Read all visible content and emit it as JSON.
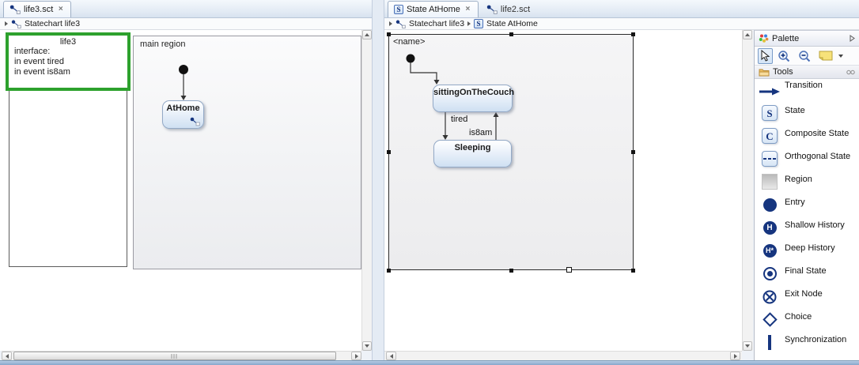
{
  "colors": {
    "navy_accent": "#16357f",
    "selection_green": "#2da12d",
    "state_border": "#93a9c6",
    "state_fill": "#cfe0f2"
  },
  "left_editor": {
    "tab_label": "life3.sct",
    "breadcrumb": {
      "item1": "Statechart life3"
    },
    "spec_box": {
      "title": "life3",
      "line1": "interface:",
      "line2": "in event tired",
      "line3": "in event is8am"
    },
    "region": {
      "label": "main region",
      "state_label": "AtHome"
    }
  },
  "right_editor": {
    "tab1_label": "State AtHome",
    "tab2_label": "life2.sct",
    "breadcrumb": {
      "item1": "Statechart life3",
      "item2": "State AtHome"
    },
    "diagram": {
      "region_name": "<name>",
      "state1": "sittingOnTheCouch",
      "state2": "Sleeping",
      "transition1": "tired",
      "transition2": "is8am"
    }
  },
  "palette": {
    "title": "Palette",
    "drawer_title": "Tools",
    "tools": [
      {
        "label": "Transition"
      },
      {
        "label": "State",
        "letter": "S"
      },
      {
        "label": "Composite State",
        "letter": "C"
      },
      {
        "label": "Orthogonal State"
      },
      {
        "label": "Region"
      },
      {
        "label": "Entry"
      },
      {
        "label": "Shallow History",
        "letter": "H"
      },
      {
        "label": "Deep History",
        "letter": "H*"
      },
      {
        "label": "Final State"
      },
      {
        "label": "Exit Node"
      },
      {
        "label": "Choice"
      },
      {
        "label": "Synchronization"
      }
    ]
  },
  "tab_icons": {
    "state_letter": "S"
  }
}
